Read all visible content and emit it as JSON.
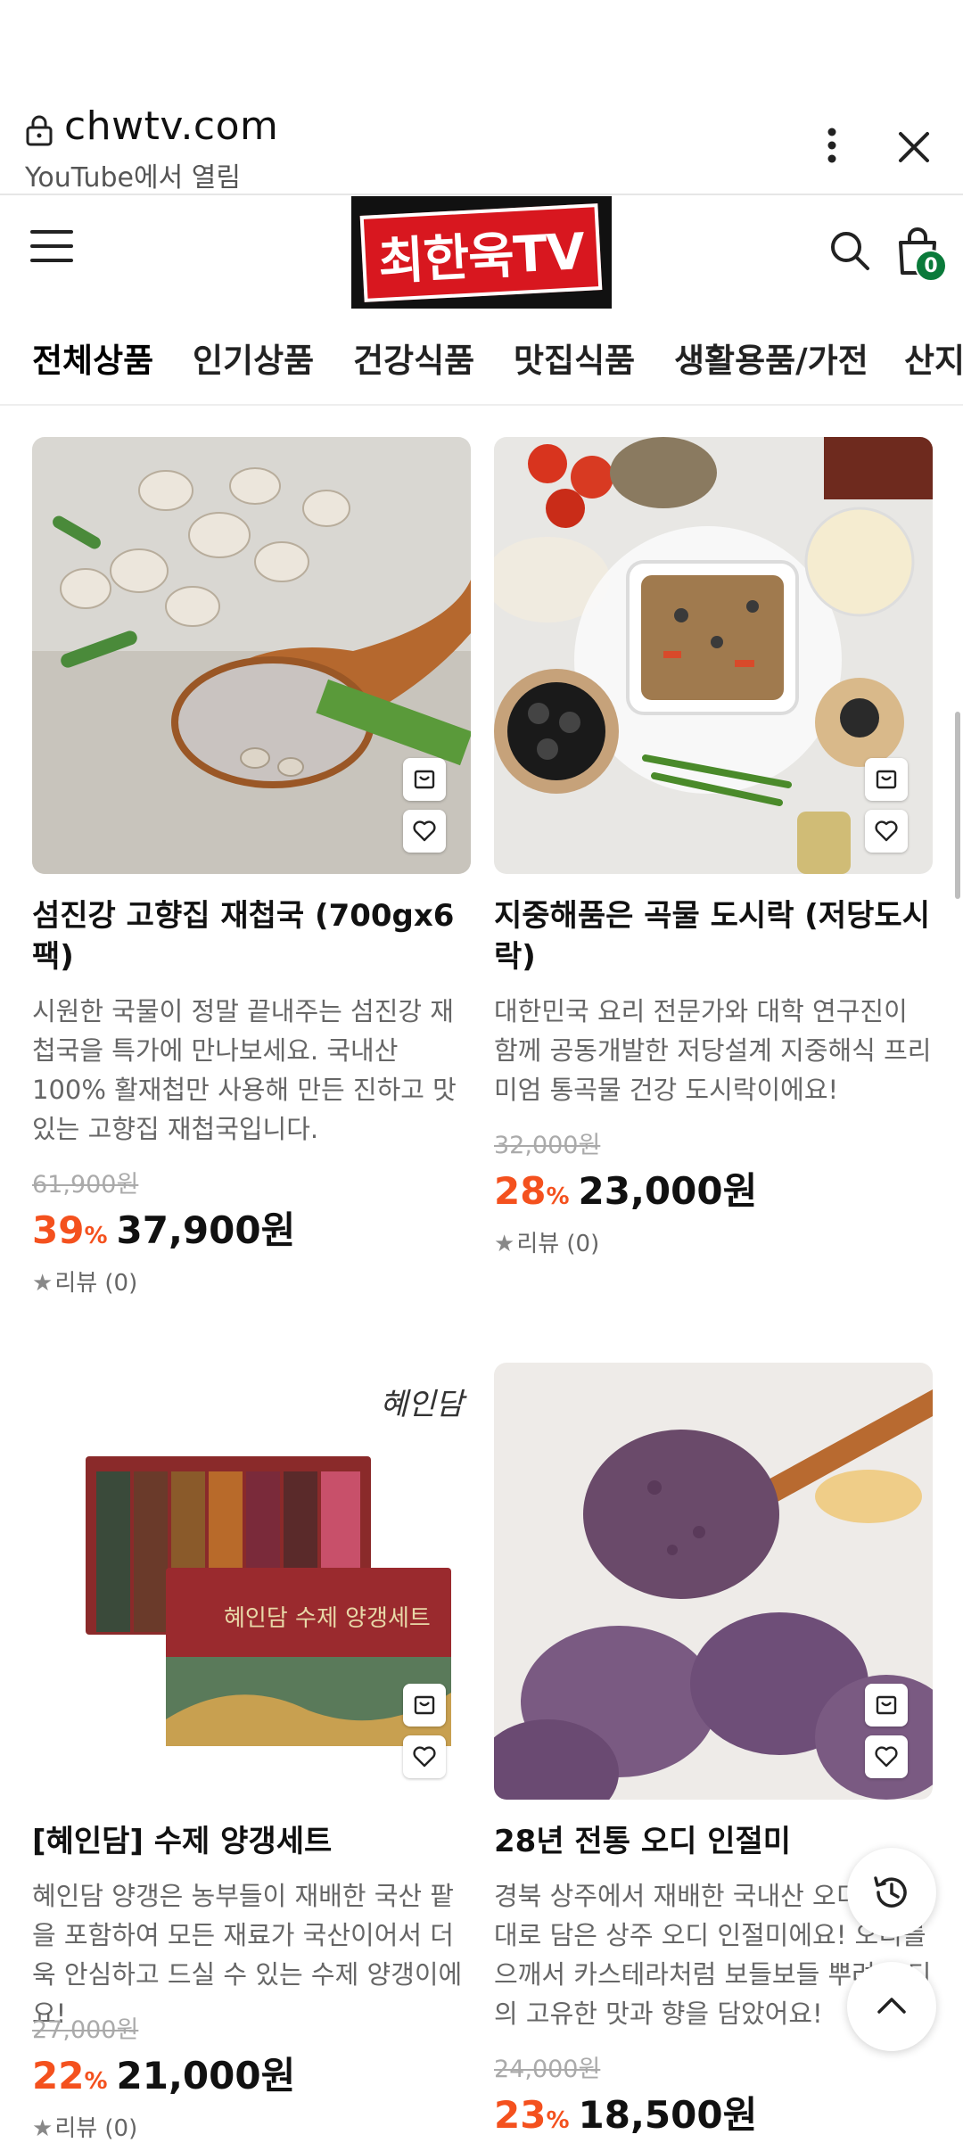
{
  "browser": {
    "url": "chwtv.com",
    "opened_in": "YouTube에서 열림"
  },
  "header": {
    "logo_text": "최한욱TV",
    "cart_count": "0"
  },
  "tabs": [
    {
      "label": "전체상품"
    },
    {
      "label": "인기상품"
    },
    {
      "label": "건강식품"
    },
    {
      "label": "맛집식품"
    },
    {
      "label": "생활용품/가전"
    },
    {
      "label": "산지"
    }
  ],
  "products": [
    {
      "name": "섬진강 고향집 재첩국 (700gx6팩)",
      "desc": "시원한 국물이 정말 끝내주는 섬진강 재첩국을 특가에 만나보세요. 국내산 100% 활재첩만 사용해 만든 진하고 맛있는 고향집 재첩국입니다.",
      "orig_price": "61,900원",
      "discount": "39",
      "pct": "%",
      "price": "37,900원",
      "review": "리뷰 (0)"
    },
    {
      "name": "지중해품은 곡물 도시락 (저당도시락)",
      "desc": "대한민국 요리 전문가와 대학 연구진이 함께 공동개발한 저당설계 지중해식 프리미엄 통곡물 건강 도시락이에요!",
      "orig_price": "32,000원",
      "discount": "28",
      "pct": "%",
      "price": "23,000원",
      "review": "리뷰 (0)"
    },
    {
      "name": "[혜인담] 수제 양갱세트",
      "desc": "혜인담 양갱은 농부들이 재배한 국산 팥을 포함하여 모든 재료가 국산이어서 더욱 안심하고 드실 수 있는 수제 양갱이에요!",
      "orig_price": "27,000원",
      "discount": "22",
      "pct": "%",
      "price": "21,000원",
      "review": "리뷰 (0)",
      "image_text": "혜인담 수제 양갱세트"
    },
    {
      "name": "28년 전통 오디 인절미",
      "desc": "경북 상주에서 재배한 국내산 오디를 그대로 담은 상주 오디 인절미에요! 오디를 으깨서 카스테라처럼 보들보들 뿌려 오디의 고유한 맛과 향을 담았어요!",
      "orig_price": "24,000원",
      "discount": "23",
      "pct": "%",
      "price": "18,500원"
    }
  ],
  "colors": {
    "discount": "#f4511e",
    "logo_red": "#d8171f",
    "badge_green": "#0a7a3a"
  },
  "icons": [
    "lock-icon",
    "more-vert-icon",
    "close-icon",
    "hamburger-menu-icon",
    "search-icon",
    "shopping-bag-icon",
    "cart-add-icon",
    "heart-icon",
    "history-icon",
    "chevron-up-icon",
    "star-icon"
  ]
}
